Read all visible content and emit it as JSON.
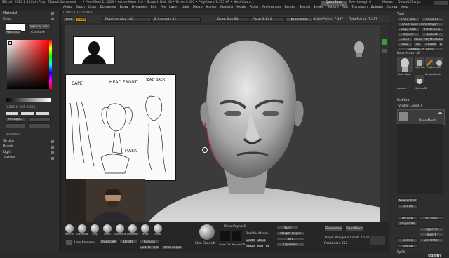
{
  "title_bar": {
    "app_title": "ZBrush 2020.1.4 [Cain Play]   ZBrush Document",
    "memory": "• Free Mem 11.1GB • Active Mem 914 • Scratch Disk 48 • Timer 0.001 • PolyCount 7.435 KP • MeshCount 1",
    "quicksave": "QuickSave",
    "see_through": "See-through 0",
    "menus": "Menus",
    "default_script": "DefaultZScript"
  },
  "menu_bar": [
    "Alpha",
    "Brush",
    "Color",
    "Document",
    "Draw",
    "Dynamics",
    "Edit",
    "File",
    "Layer",
    "Light",
    "Macro",
    "Marker",
    "Material",
    "Movie",
    "Picker",
    "Preferences",
    "Render",
    "Stencil",
    "Stroke",
    "Texture",
    "Tool",
    "Transform",
    "Zplugin",
    "Zscript",
    "Help"
  ],
  "coords": "0.000,0.712,0.468",
  "toolbar": {
    "edit_label": "Edit",
    "draw_label": "Draw",
    "rgb_intensity": "Rgb Intensity 100",
    "z_intensity": "Z Intensity 51",
    "draw_size": "Draw Size 80",
    "focal_shift": "Focal Shift 0",
    "brush_mod": "BrushMod",
    "active_points": "ActivePoints: 7,437",
    "total_points": "TotalPoints: 7,437"
  },
  "left_panel": {
    "material_title": "Material",
    "color_title": "Color",
    "switch_color": "SwitchColor",
    "gradient": "Gradient",
    "alternate": "Alternate",
    "rgb_values": "R 255   G 255   B 255",
    "fill_object": "FillObject",
    "modifiers": "Modifiers",
    "sections": [
      "Stroke",
      "Brush",
      "Light",
      "Texture"
    ]
  },
  "reference_sketch": {
    "labels": [
      "CAPE",
      "HEAD FRONT",
      "HEAD BACK",
      "MASK"
    ]
  },
  "bottom_shelf": {
    "brushes": [
      "Move S.",
      "ClayBuild",
      "Clay",
      "Pinch",
      "Standard",
      "DamStan",
      "Move",
      "Inflat"
    ],
    "live_boolean": "Live Boolean",
    "dynamesh": "DynaMesh",
    "duplicate": "Duplicate",
    "delete": "Delete",
    "split_to_parts": "Split To Parts",
    "zremesh": "ZRemesher",
    "target_polygons": "Target Polygons Count 2.5005",
    "resolution": "Resolution 552",
    "sdiv": "SDiv",
    "smt": "Smt",
    "alpha_off": "Alpha Off",
    "texture_off": "Texture Off",
    "brush_alpha": "BrushAlpha 0",
    "backface_mask": "BackfaceMask",
    "zadd": "Zadd",
    "zsub": "Zsub",
    "mrgb": "Mrgb",
    "rgb": "Rgb",
    "m": "M",
    "skin_shade": "Skin Shade4",
    "morph_target": "Morph Target",
    "dynamic": "Dynamic",
    "groups": "Groups",
    "panelloops": "Panel Loops",
    "shrink": "Split To Parts"
  },
  "right_panel": {
    "tool_title": "Tool",
    "load_tool": "Load Tool",
    "save_as": "Save As",
    "load_tools_from_project": "Load Tools From Project",
    "copy_tool": "Copy Tool",
    "paste_tool": "Paste Tool",
    "import": "Import",
    "export": "Export",
    "clone": "Clone",
    "make_polymesh": "Make PolyMesh3D",
    "goz": "GoZ",
    "all": "All",
    "visible": "Visible",
    "r": "R",
    "lightbox_tools": "Lightbox > Tools",
    "base_mesh": "Base Mesh: 48",
    "tool_names": [
      "Base Mesh",
      "Cylinder PolyMesh3D",
      "SimpleBrush",
      "Sphere",
      "Sphere3D"
    ],
    "subtool": "Subtool",
    "visible_count": "Visible Count 7",
    "subtool_item": "Base Mesh",
    "new_folder": "New Folder",
    "list_all": "List All",
    "all_low": "All Low",
    "all_high": "All High",
    "duplicate": "Duplicate",
    "append": "Append",
    "insert": "Insert",
    "delete": "Delete",
    "del_other": "Del Other",
    "del_all": "Del All",
    "split": "Split",
    "merge": "Merge",
    "boolean": "Boolean",
    "remesh": "Remesh",
    "project": "Project",
    "extract": "Extract"
  },
  "watermark": "Udemy",
  "colors": {
    "accent_orange": "#e08a00",
    "panel_bg": "#2b2b2b",
    "canvas_bg": "#3a3a3a"
  }
}
